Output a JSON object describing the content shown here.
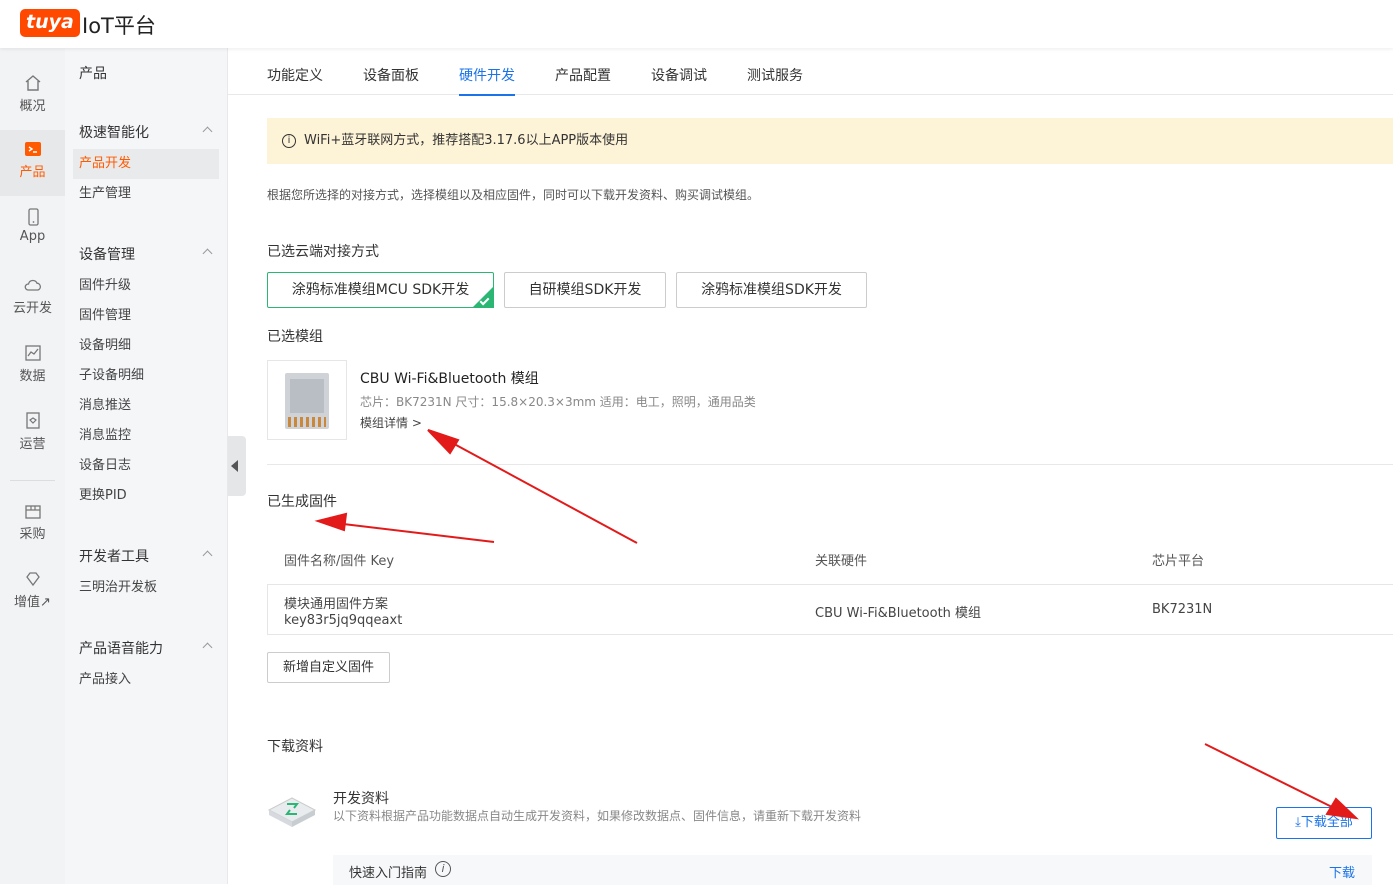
{
  "header": {
    "logo": "tuya",
    "title": "IoT平台"
  },
  "rail": [
    {
      "label": "概况",
      "icon": "home-icon"
    },
    {
      "label": "产品",
      "icon": "terminal-icon",
      "active": true
    },
    {
      "label": "App",
      "icon": "phone-icon"
    },
    {
      "label": "云开发",
      "icon": "cloud-icon"
    },
    {
      "label": "数据",
      "icon": "chart-icon"
    },
    {
      "label": "运营",
      "icon": "badge-icon"
    },
    {
      "label": "采购",
      "icon": "box-icon"
    },
    {
      "label": "增值↗",
      "icon": "diamond-icon"
    }
  ],
  "menu": {
    "top": "产品",
    "groups": [
      {
        "title": "极速智能化",
        "items": [
          "产品开发",
          "生产管理"
        ]
      },
      {
        "title": "设备管理",
        "items": [
          "固件升级",
          "固件管理",
          "设备明细",
          "子设备明细",
          "消息推送",
          "消息监控",
          "设备日志",
          "更换PID"
        ]
      },
      {
        "title": "开发者工具",
        "items": [
          "三明治开发板"
        ]
      },
      {
        "title": "产品语音能力",
        "items": [
          "产品接入"
        ]
      }
    ]
  },
  "tabs": [
    "功能定义",
    "设备面板",
    "硬件开发",
    "产品配置",
    "设备调试",
    "测试服务"
  ],
  "notice": "WiFi+蓝牙联网方式，推荐搭配3.17.6以上APP版本使用",
  "description": "根据您所选择的对接方式，选择模组以及相应固件，同时可以下载开发资料、购买调试模组。",
  "cloud": {
    "title": "已选云端对接方式",
    "options": [
      "涂鸦标准模组MCU SDK开发",
      "自研模组SDK开发",
      "涂鸦标准模组SDK开发"
    ]
  },
  "module": {
    "title": "已选模组",
    "name": "CBU Wi-Fi&Bluetooth 模组",
    "spec": "芯片：BK7231N    尺寸：15.8×20.3×3mm    适用：电工，照明，通用品类",
    "link": "模组详情 >"
  },
  "firmware": {
    "title": "已生成固件",
    "columns": [
      "固件名称/固件 Key",
      "关联硬件",
      "芯片平台"
    ],
    "row": {
      "name": "模块通用固件方案",
      "key": "key83r5jq9qqeaxt",
      "hardware": "CBU Wi-Fi&Bluetooth 模组",
      "chip": "BK7231N"
    },
    "add_button": "新增自定义固件"
  },
  "download": {
    "title": "下载资料",
    "item_title": "开发资料",
    "item_desc": "以下资料根据产品功能数据点自动生成开发资料，如果修改数据点、固件信息，请重新下载开发资料",
    "download_all": "下载全部",
    "guide": "快速入门指南",
    "guide_download": "下载"
  },
  "colors": {
    "brand": "#ff4800",
    "accent": "#1a73e8",
    "selected": "#2bb673",
    "annotation": "#e31a1a"
  }
}
